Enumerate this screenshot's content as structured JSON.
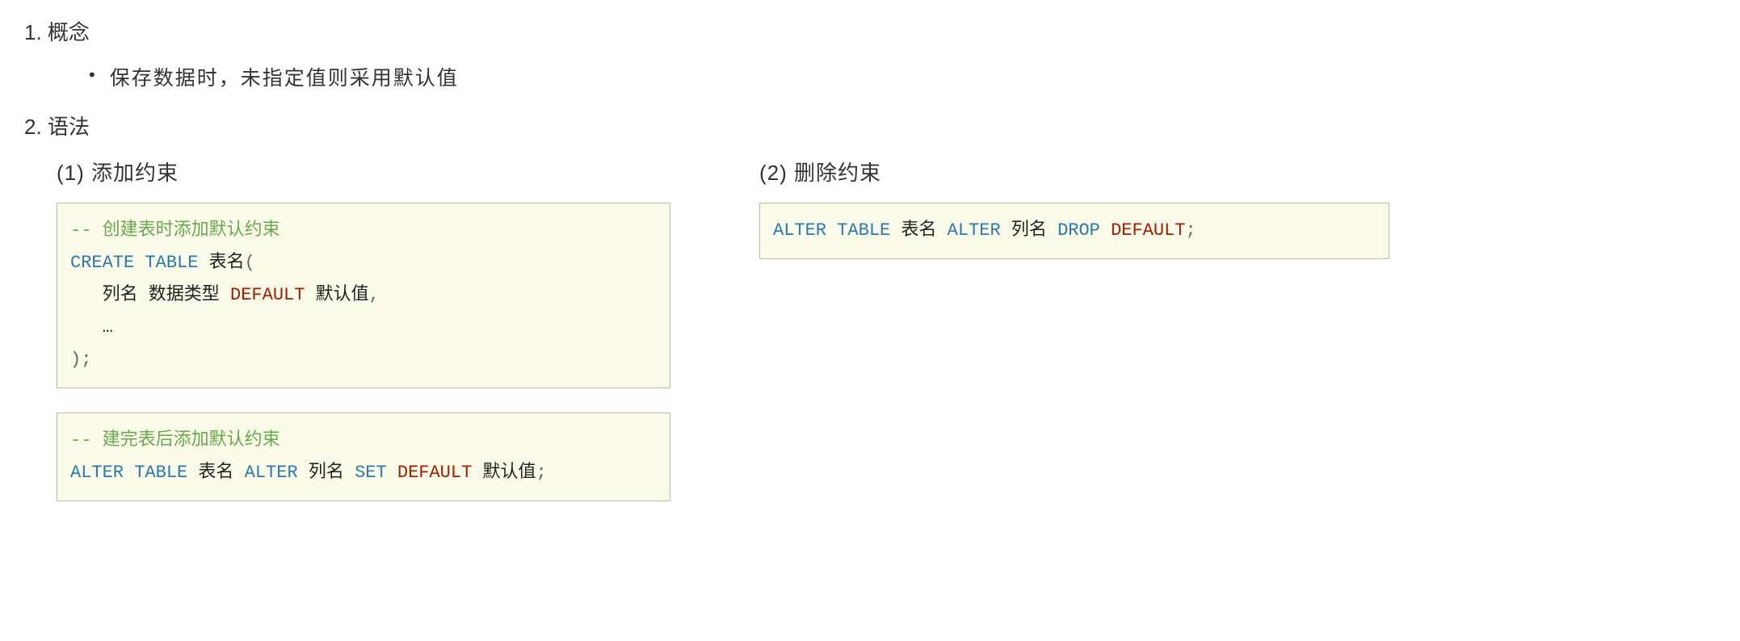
{
  "section1": {
    "num": "1.",
    "title": "概念",
    "bullet": "保存数据时，未指定值则采用默认值"
  },
  "section2": {
    "num": "2.",
    "title": "语法"
  },
  "left": {
    "heading": "(1)  添加约束",
    "block1": {
      "comment": "-- 创建表时添加默认约束",
      "l1a": "CREATE",
      "l1b": "TABLE",
      "l1c": " 表名",
      "l1paren": "(",
      "l2a": "   列名 数据类型 ",
      "l2b": "DEFAULT",
      "l2c": " 默认值",
      "l2comma": ",",
      "l3": "   …",
      "l4a": ")",
      "l4b": ";"
    },
    "block2": {
      "comment": "-- 建完表后添加默认约束",
      "l1a": "ALTER",
      "l1b": "TABLE",
      "l1c": " 表名 ",
      "l1d": "ALTER",
      "l1e": " 列名 ",
      "l1f": "SET",
      "l1g": "DEFAULT",
      "l1h": " 默认值",
      "l1semi": ";"
    }
  },
  "right": {
    "heading": "(2)  删除约束",
    "block": {
      "l1a": "ALTER",
      "l1b": "TABLE",
      "l1c": " 表名 ",
      "l1d": "ALTER",
      "l1e": " 列名 ",
      "l1f": "DROP",
      "l1g": "DEFAULT",
      "l1semi": ";"
    }
  }
}
